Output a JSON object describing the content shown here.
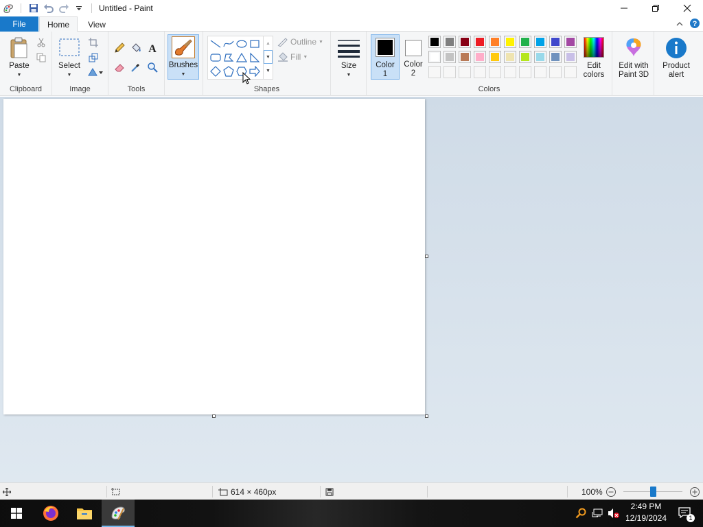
{
  "window": {
    "title": "Untitled - Paint"
  },
  "quick_access": {
    "icons": [
      "paint-app-icon",
      "save-icon",
      "undo-icon",
      "redo-icon",
      "customize-qat-icon"
    ]
  },
  "tabs": {
    "file": "File",
    "home": "Home",
    "view": "View"
  },
  "ribbon": {
    "clipboard": {
      "label": "Clipboard",
      "paste": "Paste"
    },
    "image": {
      "label": "Image",
      "select": "Select"
    },
    "tools": {
      "label": "Tools"
    },
    "brushes": {
      "label": "Brushes"
    },
    "shapes": {
      "label": "Shapes",
      "outline": "Outline",
      "fill": "Fill"
    },
    "size": {
      "label": "Size"
    },
    "color1": {
      "line1": "Color",
      "line2": "1",
      "color": "#000000"
    },
    "color2": {
      "line1": "Color",
      "line2": "2",
      "color": "#ffffff"
    },
    "colors": {
      "label": "Colors",
      "row1": [
        "#000000",
        "#7f7f7f",
        "#880015",
        "#ed1c24",
        "#ff7f27",
        "#fff200",
        "#22b14c",
        "#00a2e8",
        "#3f48cc",
        "#a349a4"
      ],
      "row2": [
        "#ffffff",
        "#c3c3c3",
        "#b97a57",
        "#ffaec9",
        "#ffc90e",
        "#efe4b0",
        "#b5e61d",
        "#99d9ea",
        "#7092be",
        "#c8bfe7"
      ]
    },
    "edit_colors": {
      "line1": "Edit",
      "line2": "colors"
    },
    "paint3d": {
      "line1": "Edit with",
      "line2": "Paint 3D"
    },
    "product_alert": {
      "line1": "Product",
      "line2": "alert"
    }
  },
  "statusbar": {
    "canvas_size": "614 × 460px",
    "zoom": "100%",
    "zoom_fraction": 0.5
  },
  "taskbar": {
    "time": "2:49 PM",
    "date": "12/19/2024",
    "notification_count": "1"
  }
}
